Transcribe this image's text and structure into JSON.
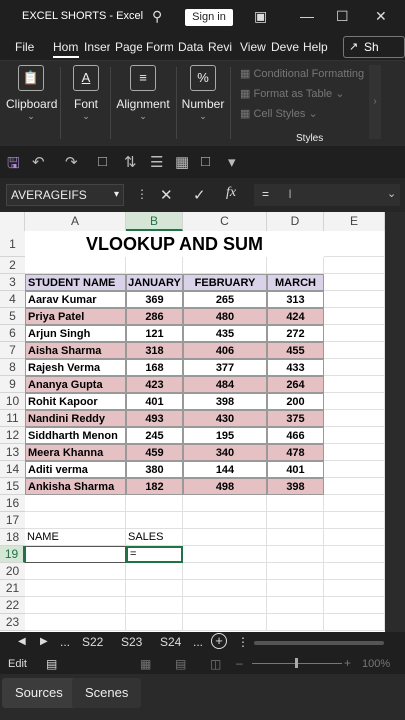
{
  "window": {
    "title": "EXCEL SHORTS  -  Excel",
    "signin": "Sign in"
  },
  "ribbon_tabs": [
    "File",
    "Hom",
    "Inser",
    "Page",
    "Form",
    "Data",
    "Revi",
    "View",
    "Deve",
    "Help"
  ],
  "share_label": "Sh",
  "ribbon": {
    "clipboard": "Clipboard",
    "font": "Font",
    "alignment": "Alignment",
    "number": "Number",
    "number_icon": "%",
    "font_icon": "A",
    "conditional_formatting": "Conditional Formatting",
    "format_as_table": "Format as Table",
    "cell_styles": "Cell Styles",
    "styles_label": "Styles"
  },
  "formula_bar": {
    "name_box": "AVERAGEIFS",
    "formula": "=",
    "fx": "fx"
  },
  "columns": [
    "A",
    "B",
    "C",
    "D",
    "E"
  ],
  "sheet": {
    "title": "VLOOKUP AND SUM",
    "headers": [
      "STUDENT NAME",
      "JANUARY",
      "FEBRUARY",
      "MARCH"
    ],
    "rows": [
      {
        "name": "Aarav Kumar",
        "jan": "369",
        "feb": "265",
        "mar": "313"
      },
      {
        "name": "Priya Patel",
        "jan": "286",
        "feb": "480",
        "mar": "424"
      },
      {
        "name": "Arjun Singh",
        "jan": "121",
        "feb": "435",
        "mar": "272"
      },
      {
        "name": "Aisha Sharma",
        "jan": "318",
        "feb": "406",
        "mar": "455"
      },
      {
        "name": "Rajesh Verma",
        "jan": "168",
        "feb": "377",
        "mar": "433"
      },
      {
        "name": "Ananya Gupta",
        "jan": "423",
        "feb": "484",
        "mar": "264"
      },
      {
        "name": "Rohit Kapoor",
        "jan": "401",
        "feb": "398",
        "mar": "200"
      },
      {
        "name": "Nandini Reddy",
        "jan": "493",
        "feb": "430",
        "mar": "375"
      },
      {
        "name": "Siddharth Menon",
        "jan": "245",
        "feb": "195",
        "mar": "466"
      },
      {
        "name": "Meera Khanna",
        "jan": "459",
        "feb": "340",
        "mar": "478"
      },
      {
        "name": "Aditi verma",
        "jan": "380",
        "feb": "144",
        "mar": "401"
      },
      {
        "name": "Ankisha Sharma",
        "jan": "182",
        "feb": "498",
        "mar": "398"
      }
    ],
    "name_label": "NAME",
    "sales_label": "SALES",
    "active_cell_value": "="
  },
  "row_numbers": [
    "1",
    "2",
    "3",
    "4",
    "5",
    "6",
    "7",
    "8",
    "9",
    "10",
    "11",
    "12",
    "13",
    "14",
    "15",
    "16",
    "17",
    "18",
    "19",
    "20",
    "21",
    "22",
    "23"
  ],
  "sheet_tabs": {
    "ellipsis": "...",
    "tabs": [
      "S22",
      "S23",
      "S24"
    ]
  },
  "status": {
    "mode": "Edit",
    "zoom": "100%"
  },
  "obs_tabs": [
    "Sources",
    "Scenes"
  ],
  "colors": {
    "header_fill": "#d9d2e9",
    "stripe_fill": "#e6c1c4",
    "accent": "#217346"
  }
}
